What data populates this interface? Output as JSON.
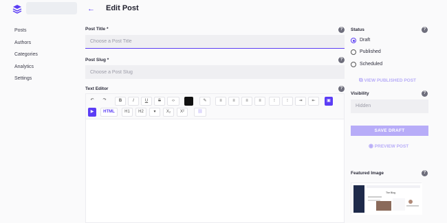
{
  "app": {
    "logo_icon": "layers-icon",
    "brand_color": "#5b3df5"
  },
  "sidebar": {
    "items": [
      {
        "label": "Posts"
      },
      {
        "label": "Authors"
      },
      {
        "label": "Categories"
      },
      {
        "label": "Analytics"
      },
      {
        "label": "Settings"
      }
    ]
  },
  "header": {
    "back_icon": "arrow-left-icon",
    "title": "Edit Post"
  },
  "form": {
    "post_title": {
      "label": "Post Title *",
      "placeholder": "Choose a Post Title",
      "value": ""
    },
    "post_slug": {
      "label": "Post Slug *",
      "placeholder": "Choose a Post Slug",
      "value": ""
    },
    "text_editor": {
      "label": "Text Editor",
      "toolbar_text": {
        "html": "HTML",
        "h1": "H1",
        "h2": "H2",
        "subscript": "X₂",
        "superscript": "X²"
      }
    }
  },
  "status": {
    "label": "Status",
    "options": [
      {
        "label": "Draft",
        "selected": true
      },
      {
        "label": "Published",
        "selected": false
      },
      {
        "label": "Scheduled",
        "selected": false
      }
    ],
    "view_published": "VIEW PUBLISHED POST"
  },
  "visibility": {
    "label": "Visibility",
    "value": "Hidden"
  },
  "actions": {
    "save_draft": "SAVE DRAFT",
    "preview": "PREVIEW POST"
  },
  "featured_image": {
    "label": "Featured Image",
    "thumb_caption": "The Blog"
  }
}
